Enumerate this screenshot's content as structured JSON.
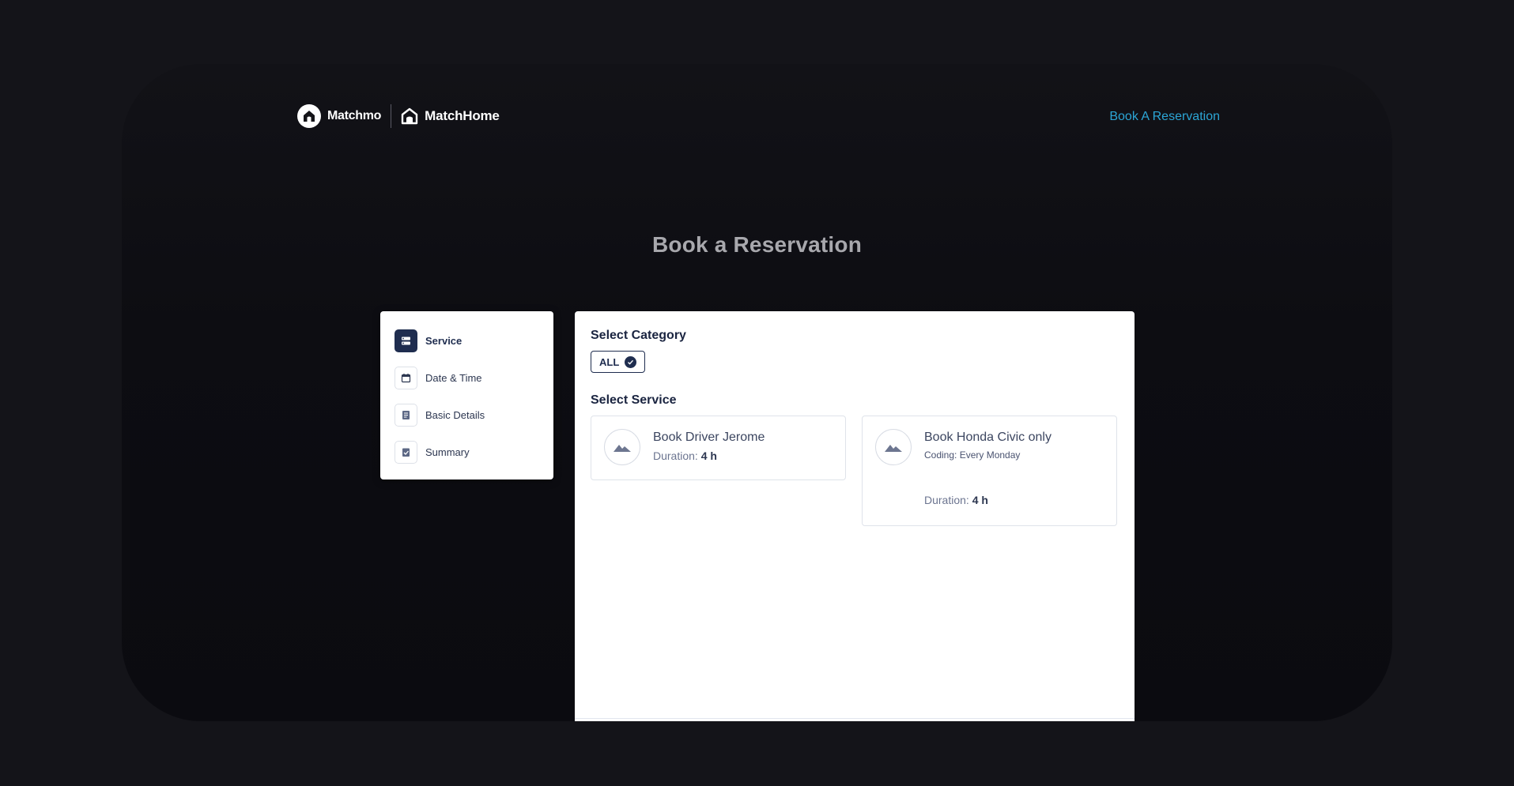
{
  "header": {
    "brand_primary": "Matchmo",
    "brand_secondary": "MatchHome",
    "nav_link": "Book A Reservation"
  },
  "page": {
    "title": "Book a Reservation"
  },
  "stepper": {
    "steps": [
      {
        "label": "Service",
        "icon": "list-icon",
        "active": true
      },
      {
        "label": "Date & Time",
        "icon": "calendar-icon",
        "active": false
      },
      {
        "label": "Basic Details",
        "icon": "document-icon",
        "active": false
      },
      {
        "label": "Summary",
        "icon": "checklist-icon",
        "active": false
      }
    ]
  },
  "category": {
    "heading": "Select Category",
    "chips": [
      {
        "label": "ALL",
        "selected": true
      }
    ]
  },
  "service": {
    "heading": "Select Service",
    "items": [
      {
        "name": "Book Driver Jerome",
        "subtitle": "",
        "duration_label": "Duration:",
        "duration_value": "4 h",
        "icon": "image-placeholder-icon"
      },
      {
        "name": "Book Honda Civic only",
        "subtitle": "Coding: Every Monday",
        "duration_label": "Duration:",
        "duration_value": "4 h",
        "icon": "image-placeholder-icon"
      }
    ]
  },
  "colors": {
    "accent_link": "#2ca6d6",
    "primary_navy": "#1f2d4f",
    "background": "#141419"
  }
}
